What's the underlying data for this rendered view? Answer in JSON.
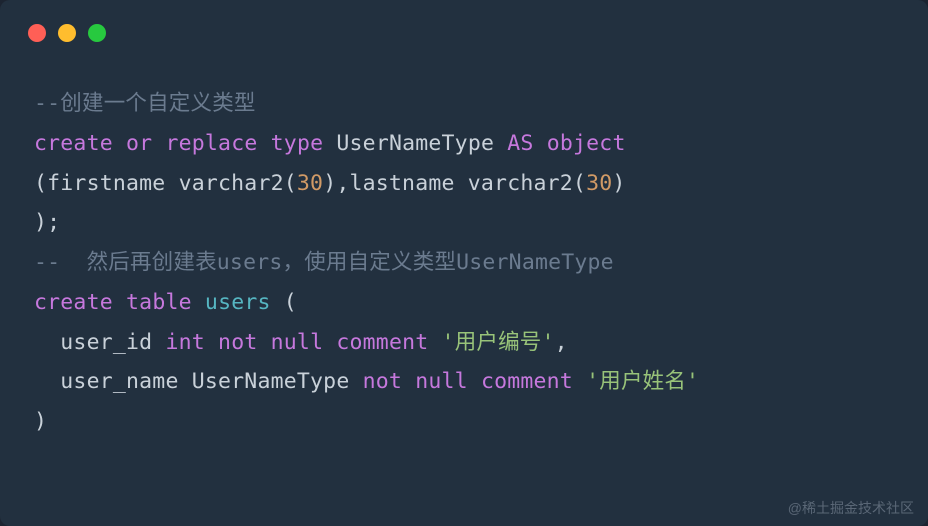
{
  "code": {
    "line1_comment": "--创建一个自定义类型",
    "line2": {
      "kw_create": "create",
      "kw_or": "or",
      "kw_replace": "replace",
      "kw_type": "type",
      "ident_usernametype": "UserNameType",
      "kw_as": "AS",
      "kw_object": "object"
    },
    "line3": {
      "open": "(firstname varchar2(",
      "num1": "30",
      "mid": "),lastname varchar2(",
      "num2": "30",
      "close": ")"
    },
    "line4": ");",
    "line5_comment": "--  然后再创建表users，使用自定义类型UserNameType",
    "line6": {
      "kw_create": "create",
      "kw_table": "table",
      "ident_users": "users",
      "open": " ("
    },
    "line7": {
      "pre": "  user_id ",
      "kw_int": "int",
      "sp1": " ",
      "kw_not": "not",
      "sp2": " ",
      "kw_null": "null",
      "sp3": " ",
      "kw_comment": "comment",
      "sp4": " ",
      "str": "'用户编号'",
      "comma": ","
    },
    "line8": {
      "pre": "  user_name UserNameType ",
      "kw_not": "not",
      "sp1": " ",
      "kw_null": "null",
      "sp2": " ",
      "kw_comment": "comment",
      "sp3": " ",
      "str": "'用户姓名'"
    },
    "line9": ")"
  },
  "watermark": "@稀土掘金技术社区"
}
